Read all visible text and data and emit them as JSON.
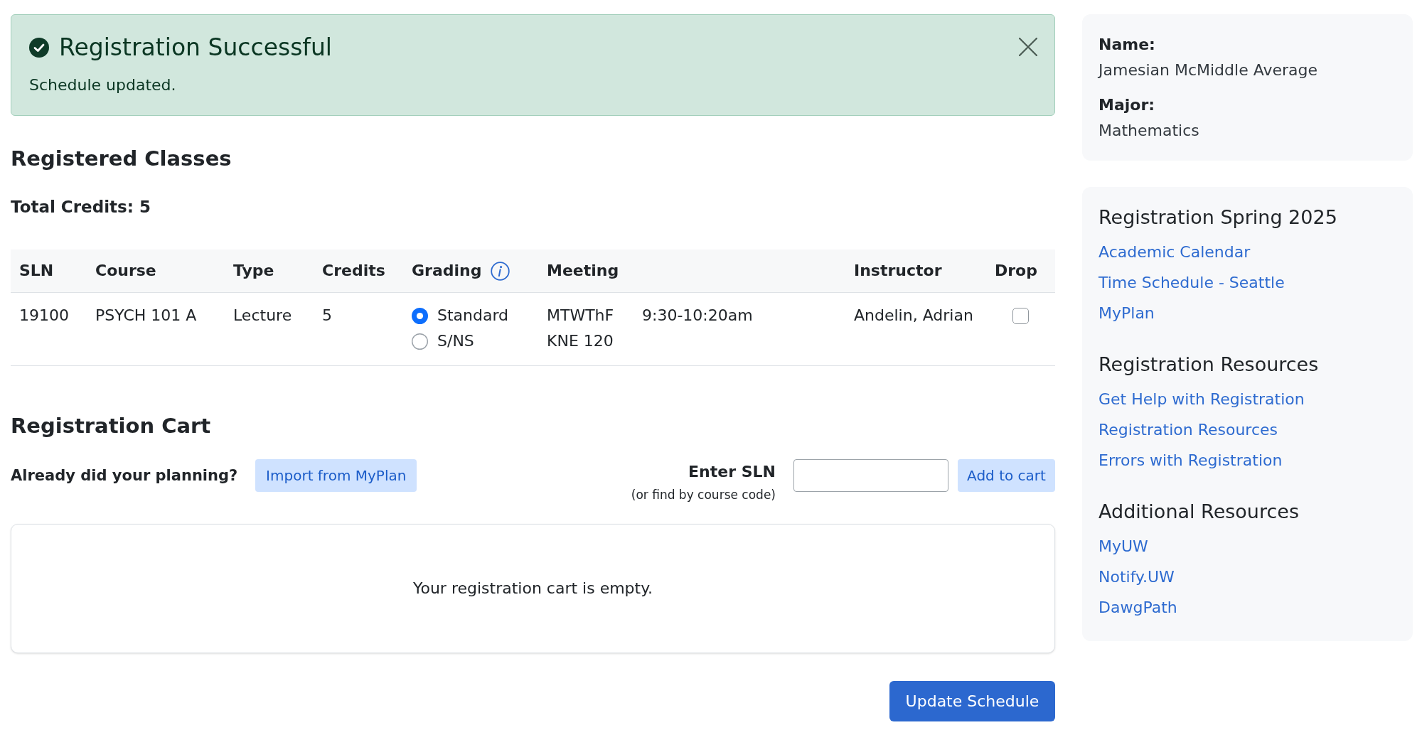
{
  "alert": {
    "title": "Registration Successful",
    "message": "Schedule updated."
  },
  "registered": {
    "title": "Registered Classes",
    "total_credits": "Total Credits: 5",
    "columns": [
      {
        "label": "SLN",
        "info": false
      },
      {
        "label": "Course",
        "info": false
      },
      {
        "label": "Type",
        "info": false
      },
      {
        "label": "Credits",
        "info": false
      },
      {
        "label": "Grading",
        "info": true
      },
      {
        "label": "Meeting",
        "info": false
      },
      {
        "label": "Instructor",
        "info": false
      },
      {
        "label": "Drop",
        "info": false
      }
    ],
    "rows": [
      {
        "sln": "19100",
        "course": "PSYCH 101 A",
        "type": "Lecture",
        "credits": "5",
        "grading": [
          {
            "label": "Standard",
            "selected": true
          },
          {
            "label": "S/NS",
            "selected": false
          }
        ],
        "meeting_days": "MTWThF",
        "meeting_location": "KNE 120",
        "meeting_time": "9:30-10:20am",
        "instructor": "Andelin, Adrian",
        "drop": {
          "checked": false
        }
      }
    ]
  },
  "cart": {
    "title": "Registration Cart",
    "planning_prompt": "Already did your planning?",
    "import_button": "Import from MyPlan",
    "sln_label": "Enter SLN",
    "sln_hint": "(or find by course code)",
    "add_button": "Add to cart",
    "empty_message": "Your registration cart is empty."
  },
  "update_button": "Update Schedule",
  "sidebar": {
    "profile": [
      {
        "label": "Name:",
        "value": "Jamesian McMiddle Average"
      },
      {
        "label": "Major:",
        "value": "Mathematics"
      }
    ],
    "sections": [
      {
        "title": "Registration Spring 2025",
        "links": [
          "Academic Calendar",
          "Time Schedule - Seattle",
          "MyPlan"
        ]
      },
      {
        "title": "Registration Resources",
        "links": [
          "Get Help with Registration",
          "Registration Resources",
          "Errors with Registration"
        ]
      },
      {
        "title": "Additional Resources",
        "links": [
          "MyUW",
          "Notify.UW",
          "DawgPath"
        ]
      }
    ]
  }
}
